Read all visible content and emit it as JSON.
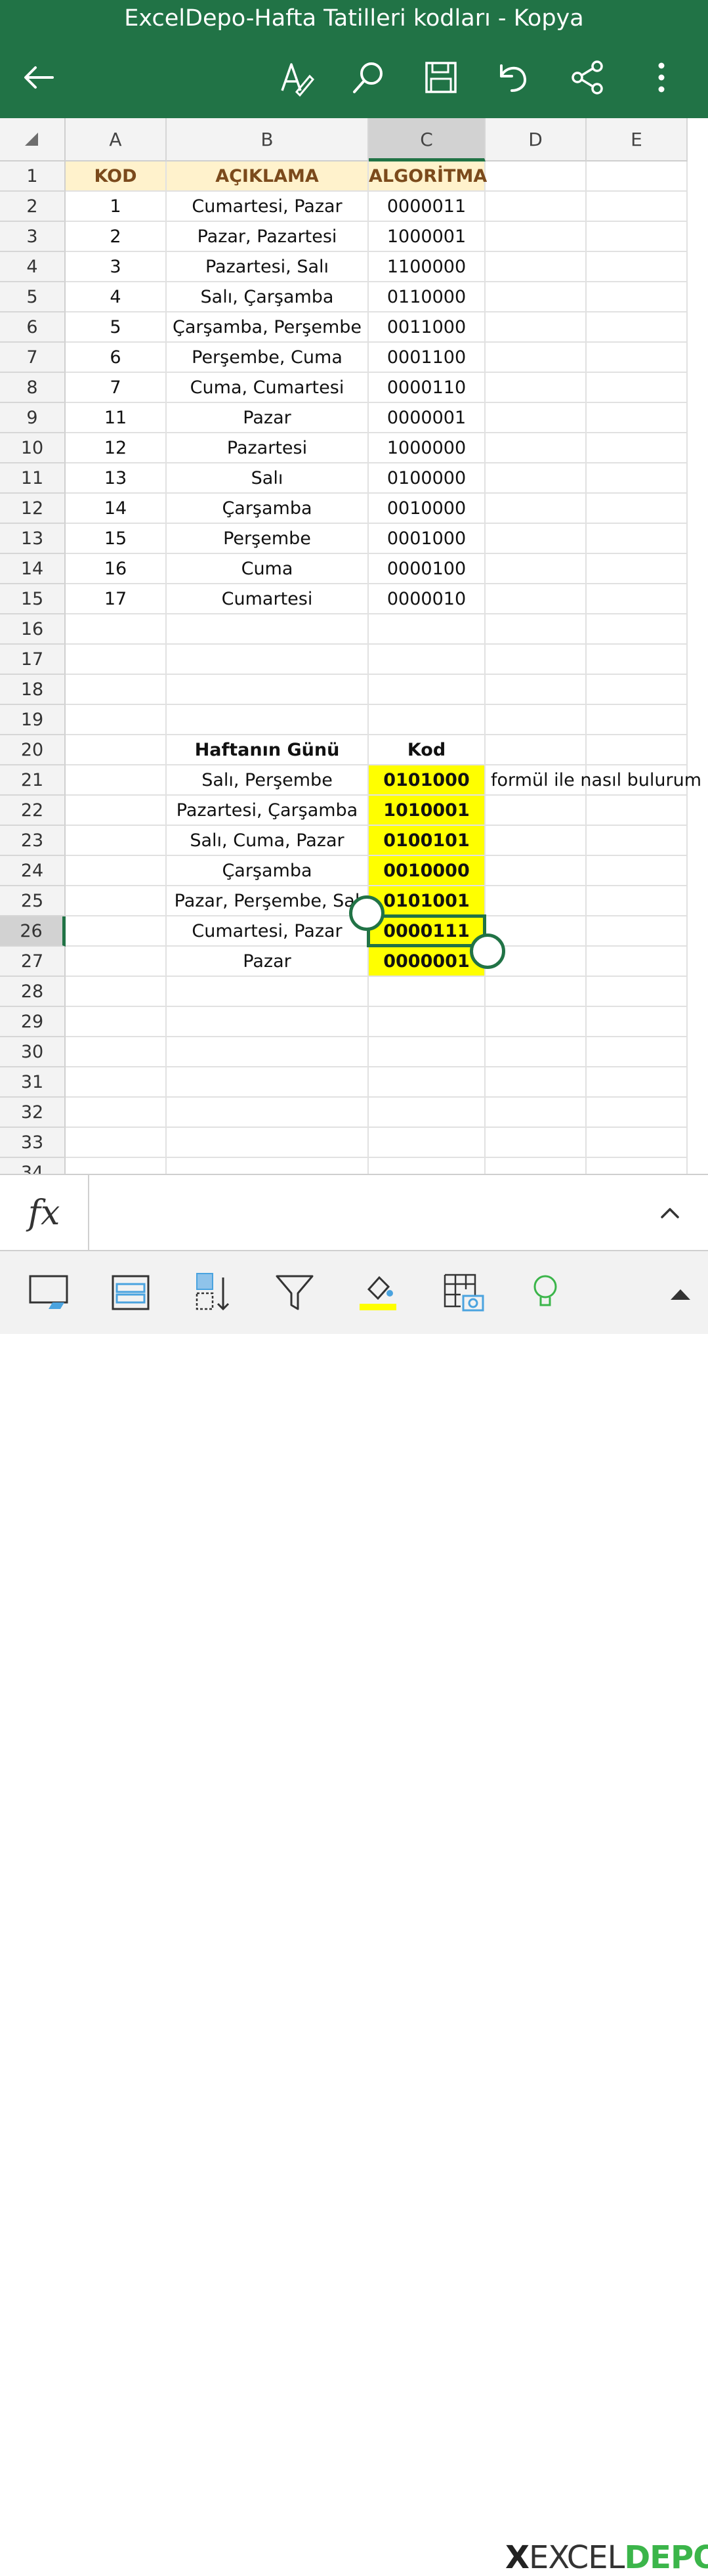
{
  "app": {
    "title": "ExcelDepo-Hafta Tatilleri kodları - Kopya",
    "accent": "#217346"
  },
  "toolbar_top": {
    "icons": [
      "back-arrow-icon",
      "draw-icon",
      "search-icon",
      "save-icon",
      "undo-icon",
      "share-icon",
      "more-icon"
    ]
  },
  "columns": [
    "A",
    "B",
    "C",
    "D",
    "E"
  ],
  "selected_column": "C",
  "rows": [
    "1",
    "2",
    "3",
    "4",
    "5",
    "6",
    "7",
    "8",
    "9",
    "10",
    "11",
    "12",
    "13",
    "14",
    "15",
    "16",
    "17",
    "18",
    "19",
    "20",
    "21",
    "22",
    "23",
    "24",
    "25",
    "26",
    "27",
    "28",
    "29",
    "30",
    "31",
    "32",
    "33"
  ],
  "partial_row": "34",
  "selected_row": "26",
  "table1": {
    "headers": [
      "KOD",
      "AÇIKLAMA",
      "ALGORİTMA"
    ],
    "rows": [
      [
        "1",
        "Cumartesi, Pazar",
        "0000011"
      ],
      [
        "2",
        "Pazar, Pazartesi",
        "1000001"
      ],
      [
        "3",
        "Pazartesi, Salı",
        "1100000"
      ],
      [
        "4",
        "Salı, Çarşamba",
        "0110000"
      ],
      [
        "5",
        "Çarşamba, Perşembe",
        "0011000"
      ],
      [
        "6",
        "Perşembe, Cuma",
        "0001100"
      ],
      [
        "7",
        "Cuma, Cumartesi",
        "0000110"
      ],
      [
        "11",
        "Pazar",
        "0000001"
      ],
      [
        "12",
        "Pazartesi",
        "1000000"
      ],
      [
        "13",
        "Salı",
        "0100000"
      ],
      [
        "14",
        "Çarşamba",
        "0010000"
      ],
      [
        "15",
        "Perşembe",
        "0001000"
      ],
      [
        "16",
        "Cuma",
        "0000100"
      ],
      [
        "17",
        "Cumartesi",
        "0000010"
      ]
    ]
  },
  "table2": {
    "headers": [
      "Haftanın Günü",
      "Kod"
    ],
    "rows": [
      [
        "Salı, Perşembe",
        "0101000"
      ],
      [
        "Pazartesi, Çarşamba",
        "1010001"
      ],
      [
        "Salı, Cuma, Pazar",
        "0100101"
      ],
      [
        "Çarşamba",
        "0010000"
      ],
      [
        "Pazar, Perşembe, Sal",
        "0101001"
      ],
      [
        "Cumartesi, Pazar",
        "0000111"
      ],
      [
        "Pazar",
        "0000001"
      ]
    ],
    "note": "formül ile nasıl bulurum"
  },
  "formula_bar": {
    "fx_label": "fx",
    "value": ""
  },
  "bottom_toolbar": {
    "icons": [
      "view-icon",
      "freeze-panes-icon",
      "sort-icon",
      "filter-icon",
      "fill-color-icon",
      "insert-picture-icon",
      "ideas-icon",
      "expand-icon"
    ]
  },
  "watermark": {
    "x": "X",
    "excel": "EXCEL",
    "depo": "DEPO"
  }
}
